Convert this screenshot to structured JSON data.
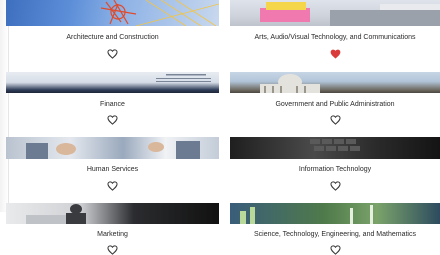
{
  "cards": [
    {
      "label": "Architecture and Construction",
      "favorited": false,
      "heart_icon": "heart-outline-icon"
    },
    {
      "label": "Arts, Audio/Visual Technology, and Communications",
      "favorited": true,
      "heart_icon": "heart-filled-icon"
    },
    {
      "label": "Finance",
      "favorited": false,
      "heart_icon": "heart-outline-icon"
    },
    {
      "label": "Government and Public Administration",
      "favorited": false,
      "heart_icon": "heart-outline-icon"
    },
    {
      "label": "Human Services",
      "favorited": false,
      "heart_icon": "heart-outline-icon"
    },
    {
      "label": "Information Technology",
      "favorited": false,
      "heart_icon": "heart-outline-icon"
    },
    {
      "label": "Marketing",
      "favorited": false,
      "heart_icon": "heart-outline-icon"
    },
    {
      "label": "Science, Technology, Engineering, and Mathematics",
      "favorited": false,
      "heart_icon": "heart-outline-icon"
    }
  ],
  "colors": {
    "heart_filled": "#d93a3a",
    "heart_outline": "#333333"
  }
}
